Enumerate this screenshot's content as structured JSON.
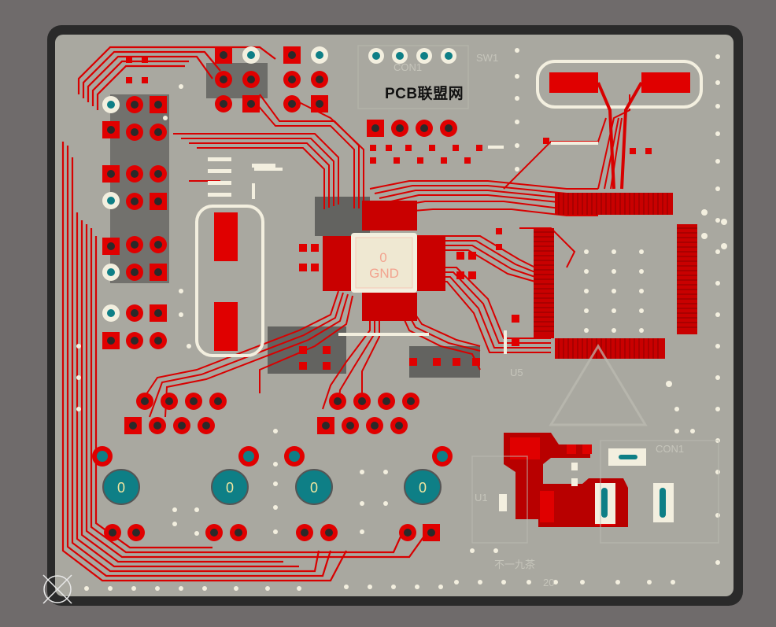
{
  "board": {
    "watermark": "PCB联盟网",
    "center_pad_labels": [
      "0",
      "GND"
    ],
    "big_pad_labels": [
      "0",
      "0",
      "0",
      "0"
    ],
    "silkscreen_faint": [
      "U1",
      "CON1",
      "U5",
      "SW1",
      "CON1",
      "不一九茶",
      "20"
    ]
  },
  "colors": {
    "background": "#6f6b6b",
    "board_edge": "#2b2b2b",
    "board_fill": "#a9a8a0",
    "copper_top": "#e00000",
    "copper_dark": "#b30000",
    "pad_white": "#f3efdf",
    "via_teal": "#0e7f86",
    "silkscreen": "#fbf7e6",
    "ground_pour": "#3a3a3a"
  }
}
